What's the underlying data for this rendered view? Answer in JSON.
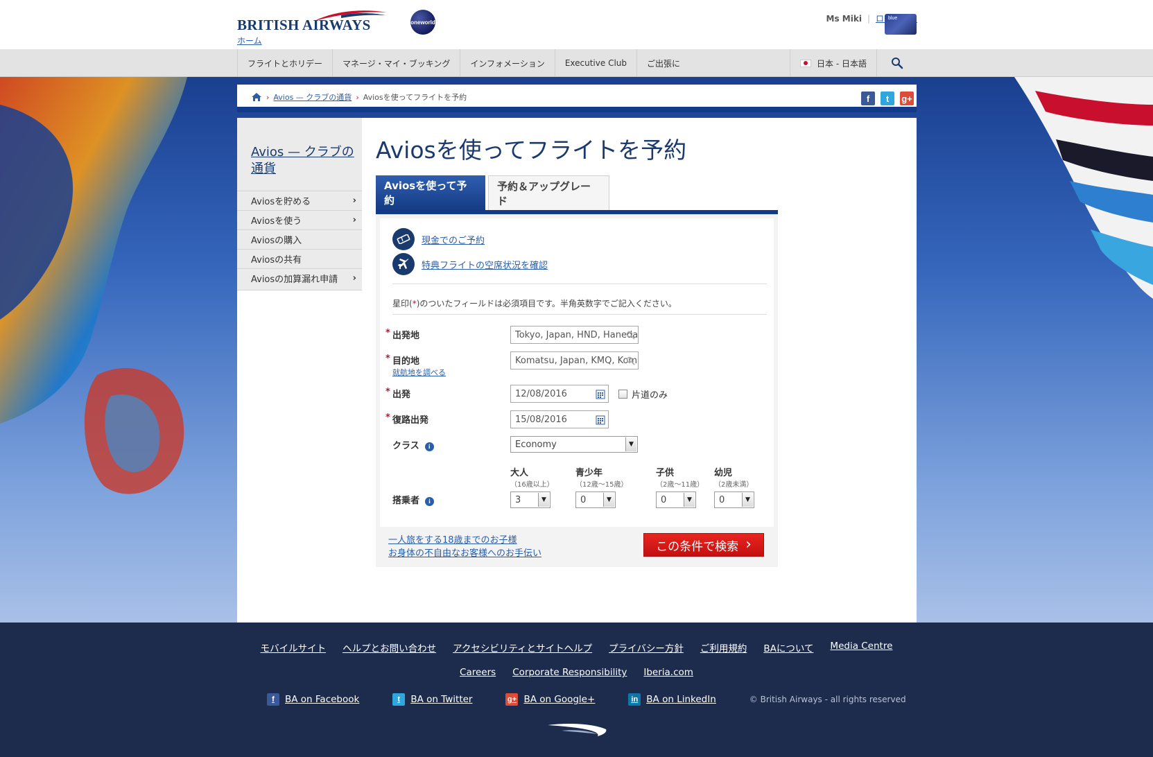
{
  "header": {
    "logo_text": "BRITISH AIRWAYS",
    "home_link": "ホーム",
    "oneworld": "oneworld",
    "user_name": "Ms Miki",
    "logout": "ログアウト",
    "card_label": "blue"
  },
  "nav": {
    "items": [
      "フライトとホリデー",
      "マネージ・マイ・ブッキング",
      "インフォメーション",
      "Executive Club",
      "ご出張に"
    ],
    "language": "日本 - 日本語"
  },
  "breadcrumb": {
    "items": [
      "Avios — クラブの通貨",
      "Aviosを使ってフライトを予約"
    ]
  },
  "sidebar": {
    "title": "Avios — クラブの通貨",
    "items": [
      {
        "label": "Aviosを貯める",
        "chevron": true
      },
      {
        "label": "Aviosを使う",
        "chevron": true
      },
      {
        "label": "Aviosの購入",
        "chevron": false
      },
      {
        "label": "Aviosの共有",
        "chevron": false
      },
      {
        "label": "Aviosの加算漏れ申請",
        "chevron": true
      }
    ]
  },
  "main": {
    "title": "Aviosを使ってフライトを予約",
    "tabs": [
      "Aviosを使って予約",
      "予約＆アップグレード"
    ],
    "quick_links": [
      "現金でのご予約",
      "特典フライトの空席状況を確認"
    ],
    "note_pre": "星印(",
    "note_star": "*",
    "note_post": ")のついたフィールドは必須項目です。半角英数字でご記入ください。",
    "form": {
      "origin_label": "出発地",
      "origin_value": "Tokyo, Japan, HND, Haneda",
      "destination_label": "目的地",
      "destination_value": "Komatsu, Japan, KMQ, Komatsu",
      "route_link": "就航地を調べる",
      "depart_label": "出発",
      "depart_value": "12/08/2016",
      "oneway_label": "片道のみ",
      "return_label": "復路出発",
      "return_value": "15/08/2016",
      "class_label": "クラス",
      "class_value": "Economy",
      "pax_label": "搭乗者",
      "pax": [
        {
          "label": "大人",
          "sub": "（16歳以上）",
          "value": "3"
        },
        {
          "label": "青少年",
          "sub": "（12歳～15歳）",
          "value": "0"
        },
        {
          "label": "子供",
          "sub": "（2歳～11歳）",
          "value": "0"
        },
        {
          "label": "幼児",
          "sub": "（2歳未満）",
          "value": "0"
        }
      ]
    },
    "bottom_links": [
      "一人旅をする18歳までのお子様",
      "お身体の不自由なお客様へのお手伝い"
    ],
    "search_button": "この条件で検索"
  },
  "footer": {
    "row1": [
      "モバイルサイト",
      "ヘルプとお問い合わせ",
      "アクセシビリティとサイトヘルプ",
      "プライバシー方針",
      "ご利用規約",
      "BAについて",
      "Media Centre"
    ],
    "row2": [
      "Careers",
      "Corporate Responsibility",
      "Iberia.com"
    ],
    "social": [
      "BA on Facebook",
      "BA on Twitter",
      "BA on Google+",
      "BA on LinkedIn"
    ],
    "copyright": "© British Airways - all rights reserved"
  },
  "colors": {
    "brand_navy": "#1a3a6e",
    "accent_red": "#c8102e",
    "footer_bg": "#1d2b4c",
    "link_blue": "#2a5ea8"
  }
}
